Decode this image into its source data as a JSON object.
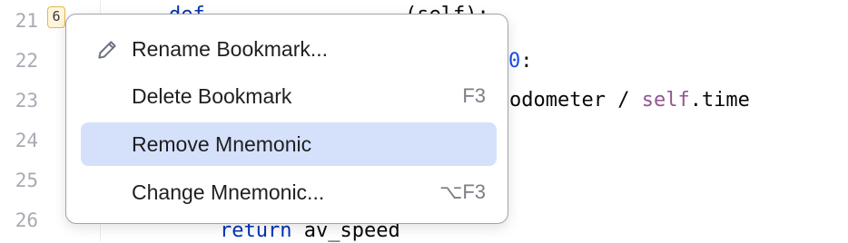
{
  "editor": {
    "line_numbers": [
      "21",
      "22",
      "23",
      "24",
      "25",
      "26"
    ],
    "bookmark_mnemonic": "6",
    "visible_code": {
      "line21": {
        "kw": "def",
        "rest": "",
        "tail": "(self):"
      },
      "line22": {
        "num": "0",
        "tail": ":"
      },
      "line23": {
        "text": "odometer / ",
        "self": "self",
        "tail": ".time"
      },
      "line26": {
        "kw": "return",
        "rest": " av_speed"
      }
    }
  },
  "context_menu": {
    "items": [
      {
        "label": "Rename Bookmark...",
        "icon": "pencil-icon",
        "shortcut": ""
      },
      {
        "label": "Delete Bookmark",
        "icon": "",
        "shortcut": "F3"
      },
      {
        "label": "Remove Mnemonic",
        "icon": "",
        "shortcut": "",
        "selected": true
      },
      {
        "label": "Change Mnemonic...",
        "icon": "",
        "shortcut": "⌥F3"
      }
    ]
  },
  "colors": {
    "selection": "#d5e1fb",
    "keyword": "#0033b3",
    "self": "#94558d",
    "bookmark_border": "#e6b84a"
  }
}
